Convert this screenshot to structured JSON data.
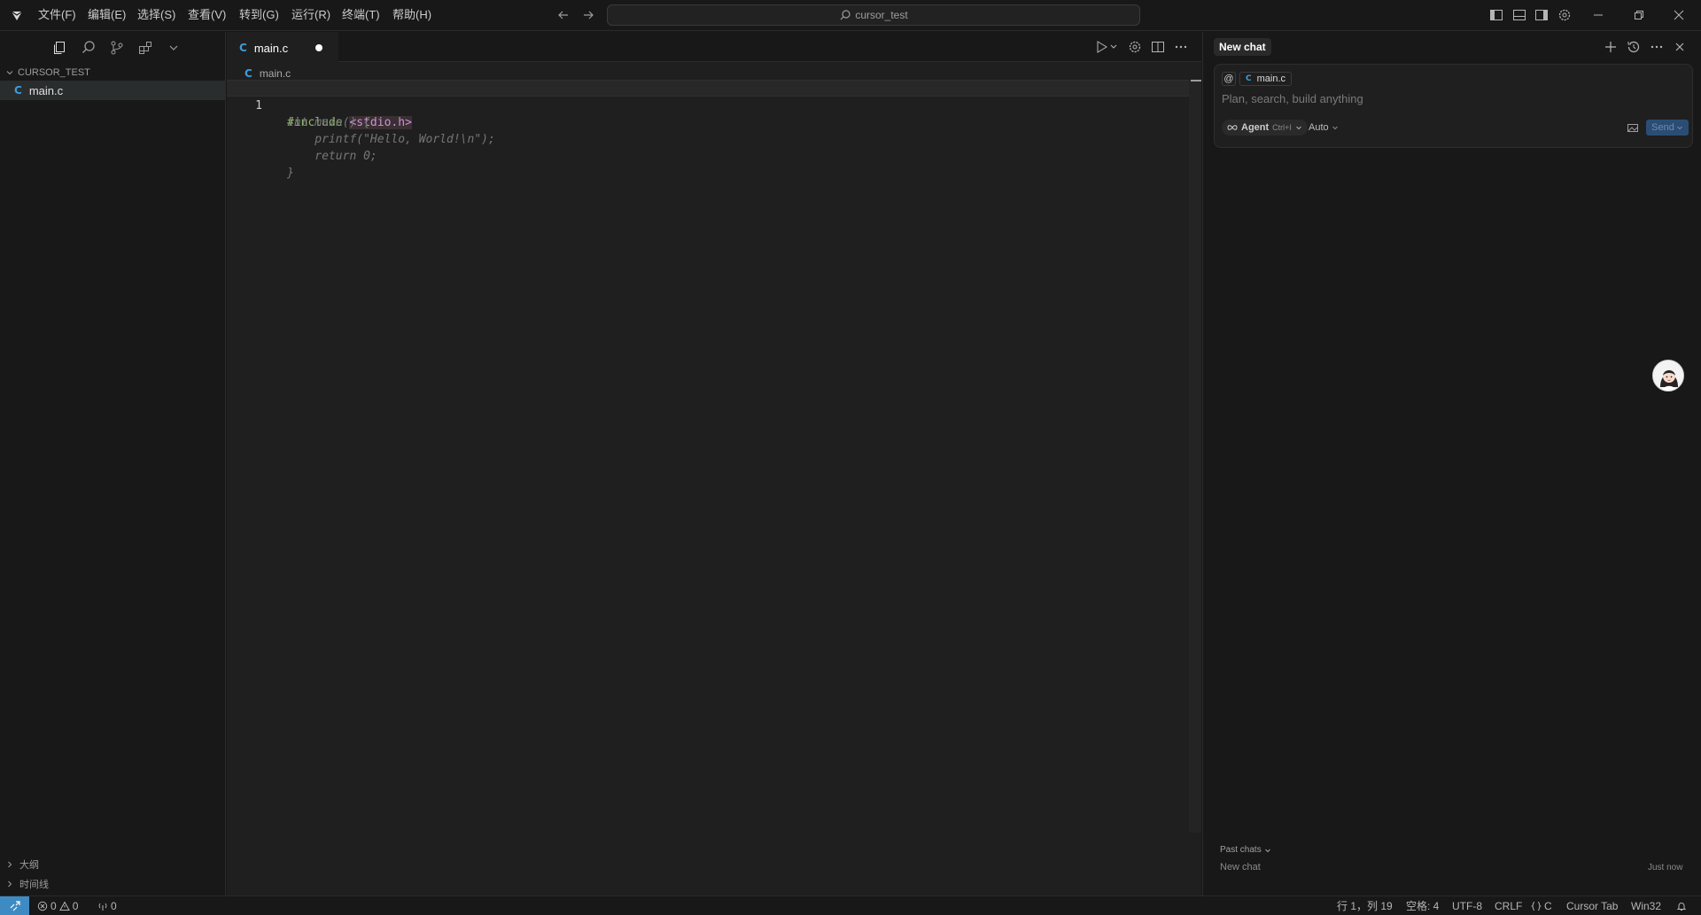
{
  "menu": [
    "文件(F)",
    "编辑(E)",
    "选择(S)",
    "查看(V)",
    "转到(G)",
    "运行(R)",
    "终端(T)",
    "帮助(H)"
  ],
  "command_center": {
    "label": "cursor_test"
  },
  "sidebar": {
    "section_title": "CURSOR_TEST",
    "file": {
      "icon": "C",
      "name": "main.c"
    },
    "outline_label": "大纲",
    "timeline_label": "时间线"
  },
  "editor": {
    "tab": {
      "icon": "C",
      "name": "main.c"
    },
    "breadcrumb": {
      "icon": "C",
      "name": "main.c"
    },
    "line_number": "1",
    "line1_pre": "#include",
    "line1_hdr": "<stdio.h>",
    "ghost_lines": [
      "int main() {",
      "    printf(\"Hello, World!\\n\");",
      "    return 0;",
      "}"
    ]
  },
  "chat": {
    "title": "New chat",
    "context_at": "@",
    "context_file_icon": "C",
    "context_file": "main.c",
    "placeholder": "Plan, search, build anything",
    "agent_label": "Agent",
    "agent_shortcut": "Ctrl+I",
    "model": "Auto",
    "send_label": "Send",
    "past_chats_label": "Past chats",
    "past_item_title": "New chat",
    "past_item_time": "Just now"
  },
  "status": {
    "errors": "0",
    "warnings": "0",
    "ports": "0",
    "position": "行 1，列 19",
    "spaces": "空格: 4",
    "encoding": "UTF-8",
    "eol": "CRLF",
    "language": "C",
    "cursor_tab": "Cursor Tab",
    "platform": "Win32"
  },
  "colors": {
    "accent": "#3e8bc4",
    "c_icon": "#3b9ddb",
    "send_bg": "#2c4d73"
  }
}
